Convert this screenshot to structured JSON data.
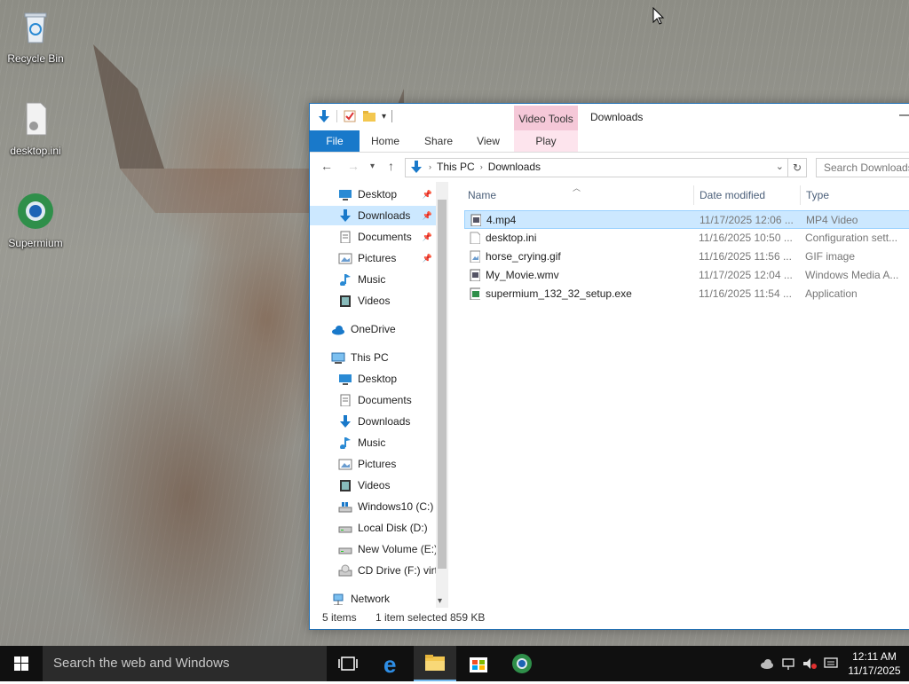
{
  "desktop": {
    "icons": [
      {
        "label": "Recycle Bin"
      },
      {
        "label": "desktop.ini"
      },
      {
        "label": "Supermium"
      }
    ]
  },
  "explorer": {
    "window_title": "Downloads",
    "contextual_tab_group": "Video Tools",
    "ribbon_tabs": {
      "file": "File",
      "home": "Home",
      "share": "Share",
      "view": "View",
      "play": "Play"
    },
    "address": {
      "root": "This PC",
      "folder": "Downloads"
    },
    "search_placeholder": "Search Downloads",
    "nav": {
      "quick_access": [
        {
          "label": "Desktop",
          "icon": "desktop-icon",
          "pinned": true
        },
        {
          "label": "Downloads",
          "icon": "download-arrow-icon",
          "pinned": true,
          "selected": true
        },
        {
          "label": "Documents",
          "icon": "documents-icon",
          "pinned": true
        },
        {
          "label": "Pictures",
          "icon": "pictures-icon",
          "pinned": true
        },
        {
          "label": "Music",
          "icon": "music-note-icon"
        },
        {
          "label": "Videos",
          "icon": "videos-icon"
        }
      ],
      "onedrive": "OneDrive",
      "this_pc": "This PC",
      "this_pc_items": [
        {
          "label": "Desktop",
          "icon": "desktop-icon"
        },
        {
          "label": "Documents",
          "icon": "documents-icon"
        },
        {
          "label": "Downloads",
          "icon": "download-arrow-icon"
        },
        {
          "label": "Music",
          "icon": "music-note-icon"
        },
        {
          "label": "Pictures",
          "icon": "pictures-icon"
        },
        {
          "label": "Videos",
          "icon": "videos-icon"
        },
        {
          "label": "Windows10 (C:)",
          "icon": "windows-drive-icon"
        },
        {
          "label": "Local Disk (D:)",
          "icon": "drive-icon"
        },
        {
          "label": "New Volume (E:)",
          "icon": "drive-icon"
        },
        {
          "label": "CD Drive (F:) virt",
          "icon": "cd-drive-icon"
        }
      ],
      "network": "Network"
    },
    "columns": {
      "name": "Name",
      "date": "Date modified",
      "type": "Type"
    },
    "files": [
      {
        "name": "4.mp4",
        "date": "11/17/2025 12:06 ...",
        "type": "MP4 Video",
        "selected": true
      },
      {
        "name": "desktop.ini",
        "date": "11/16/2025 10:50 ...",
        "type": "Configuration sett..."
      },
      {
        "name": "horse_crying.gif",
        "date": "11/16/2025 11:56 ...",
        "type": "GIF image"
      },
      {
        "name": "My_Movie.wmv",
        "date": "11/17/2025 12:04 ...",
        "type": "Windows Media A..."
      },
      {
        "name": "supermium_132_32_setup.exe",
        "date": "11/16/2025 11:54 ...",
        "type": "Application"
      }
    ],
    "status": {
      "count": "5 items",
      "selection": "1 item selected",
      "size": "859 KB"
    }
  },
  "taskbar": {
    "search_placeholder": "Search the web and Windows",
    "clock_time": "12:11 AM",
    "clock_date": "11/17/2025"
  },
  "colors": {
    "accent": "#1979ca",
    "selection": "#cce8ff",
    "video_tools": "#f5c8d8"
  }
}
